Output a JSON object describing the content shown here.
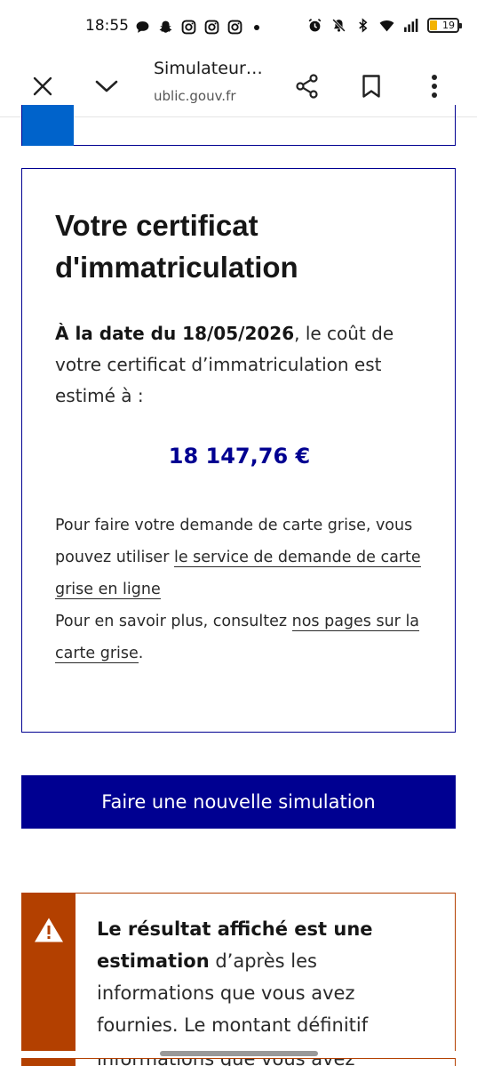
{
  "status_bar": {
    "time": "18:55",
    "battery": "19",
    "left_icons": [
      "chat-bubble-icon",
      "snapchat-icon",
      "instagram-icon",
      "instagram-icon",
      "instagram-icon",
      "more-notifications-dot"
    ],
    "right_icons": [
      "alarm-icon",
      "mute-icon",
      "bluetooth-icon",
      "wifi-icon",
      "signal-icon",
      "battery-icon"
    ]
  },
  "browser": {
    "title": "Simulateur…",
    "url": "ublic.gouv.fr",
    "icons": [
      "close-icon",
      "chevron-down-icon",
      "share-icon",
      "bookmark-icon",
      "more-vert-icon"
    ]
  },
  "result": {
    "title": "Votre certificat d'immatriculation",
    "date_prefix": "À la date du 18/05/2026",
    "desc_rest": ", le coût de votre certificat d’immatriculation est estimé à :",
    "amount": "18 147,76 €",
    "info_line1": "Pour faire votre demande de carte grise, vous pouvez utiliser ",
    "link1": "le service de demande de carte grise en ligne",
    "info_line2": "Pour en savoir plus, consultez ",
    "link2": "nos pages sur la carte grise",
    "info_end": "."
  },
  "button": {
    "new_simulation": "Faire une nouvelle simulation"
  },
  "alert": {
    "bold1": "Le résultat affiché est une estimation",
    "rest": " d’après les informations que vous avez fournies. Le montant définitif",
    "next_partial": "informations que vous avez"
  },
  "colors": {
    "primary": "#000091",
    "accent_blue": "#0063cb",
    "warning": "#b34000"
  }
}
